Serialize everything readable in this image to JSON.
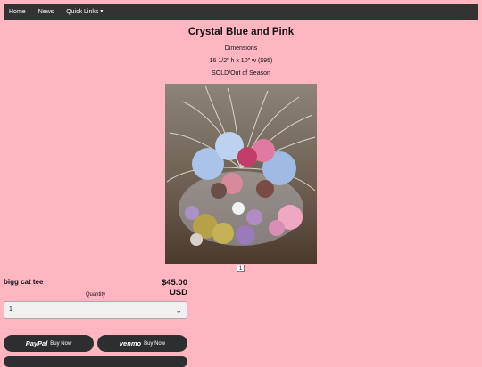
{
  "nav": {
    "items": [
      "Home",
      "News",
      "Quick Links"
    ]
  },
  "page": {
    "title": "Crystal Blue and Pink",
    "dimensions_heading": "Dimensions",
    "dimensions_value": "16 1/2\" h x 10\" w ($95)",
    "status": "SOLD/Out of Season",
    "pager_current": "1"
  },
  "product": {
    "name": "bigg cat tee",
    "price": "$45.00 USD",
    "quantity_label": "Quantity",
    "quantity_value": "1"
  },
  "payment": {
    "paypal_brand": "PayPal",
    "paypal_label": "Buy Now",
    "venmo_brand": "venmo",
    "venmo_label": "Buy Now"
  }
}
